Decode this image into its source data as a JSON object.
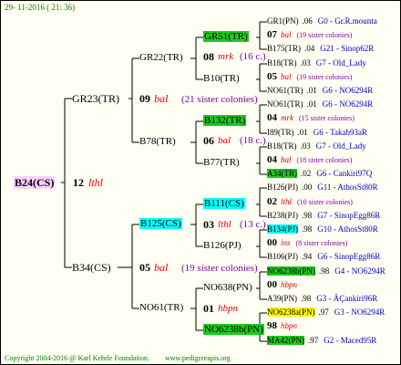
{
  "header": {
    "date": "29- 11-2016 ( 21: 36)"
  },
  "footer": {
    "copyright": "Copyright 2004-2016 @ Karl Kehrle Foundation.",
    "url": "www.pedigreeapis.org"
  },
  "colors": {
    "root_highlight": "#ffd0ff",
    "green_highlight": "#1ec81e",
    "cyan_highlight": "#00ffff",
    "yellow_highlight": "#ffff00",
    "lines": "#000000",
    "sister_colonies_text": "#8000a0",
    "ancestry_code_text": "#0000c0",
    "footer_text": "#008000"
  },
  "root": {
    "code": "B24(CS)",
    "num": "12",
    "tag": "lthl"
  },
  "gen1": [
    {
      "code": "GR23(TR)"
    },
    {
      "code": "B34(CS)"
    }
  ],
  "gen2_left": {
    "num": "09",
    "tag": "bal",
    "sister": "(21 sister colonies)"
  },
  "gen2_right": {
    "num": "05",
    "tag": "bal",
    "sister": "(19 sister colonies)"
  },
  "gen2": [
    {
      "code": "GR22(TR)"
    },
    {
      "code": "B78(TR)"
    },
    {
      "code": "B125(CS)"
    },
    {
      "code": "NO61(TR)"
    }
  ],
  "gen3_info": [
    {
      "num": "08",
      "tag": "mrk",
      "sister": "(16 c.)"
    },
    {
      "num": "06",
      "tag": "bal",
      "sister": "(18 c.)"
    },
    {
      "num": "03",
      "tag": "lthl",
      "sister": "(13 c.)"
    },
    {
      "num": "01",
      "tag": "hbpn",
      "sister": ""
    }
  ],
  "gen3": [
    {
      "code": "GR51(TR)"
    },
    {
      "code": "B10(TR)"
    },
    {
      "code": "B132(TR)"
    },
    {
      "code": "B77(TR)"
    },
    {
      "code": "B111(CS)"
    },
    {
      "code": "B126(PJ)"
    },
    {
      "code": "NO638(PN)"
    },
    {
      "code": "NO6238b(PN)"
    }
  ],
  "gen4_rows": [
    {
      "a": "GR1(PN)",
      "b": ".06",
      "c": "G0 - Gr.R.mounta"
    },
    {
      "a": "07",
      "b": "bal",
      "c": "(19 sister colonies)"
    },
    {
      "a": "B175(TR)",
      "b": ".04",
      "c": "G21 - Sinop62R"
    },
    {
      "a": "B18(TR)",
      "b": ".03",
      "c": "G7 - Old_Lady"
    },
    {
      "a": "05",
      "b": "bal",
      "c": "(19 sister colonies)"
    },
    {
      "a": "NO61(TR)",
      "b": ".01",
      "c": "G6 - NO6294R"
    },
    {
      "a": "NO61(TR)",
      "b": ".01",
      "c": "G6 - NO6294R"
    },
    {
      "a": "04",
      "b": "mrk",
      "c": "(15 sister colonies)"
    },
    {
      "a": "I89(TR)",
      "b": ".01",
      "c": "G6 - Takab93aR"
    },
    {
      "a": "B18(TR)",
      "b": ".03",
      "c": "G7 - Old_Lady"
    },
    {
      "a": "04",
      "b": "bal",
      "c": "(18 sister colonies)"
    },
    {
      "a": "A34(TR)",
      "b": ".02",
      "c": "G6 - Cankiri97Q"
    },
    {
      "a": "B126(PJ)",
      "b": ".00",
      "c": "G11 - AthosSt80R"
    },
    {
      "a": "02",
      "b": "lthl",
      "c": "(10 sister colonies)"
    },
    {
      "a": "B238(PJ)",
      "b": ".98",
      "c": "G7 - SinopEgg86R"
    },
    {
      "a": "B134(PJ)",
      "b": ".98",
      "c": "G10 - AthosSt80R"
    },
    {
      "a": "00",
      "b": "ins",
      "c": "(8 sister colonies)"
    },
    {
      "a": "B106(PJ)",
      "b": ".94",
      "c": "G6 - SinopEgg86R"
    },
    {
      "a": "NO6238b(PN)",
      "b": ".98",
      "c": "G4 - NO6294R"
    },
    {
      "a": "00",
      "b": "hbpn",
      "c": ""
    },
    {
      "a": "A39(PN)",
      "b": ".98",
      "c": "G3 - ÄÇankiri96R"
    },
    {
      "a": "NO6238a(PN)",
      "b": ".97",
      "c": "G3 - NO6294R"
    },
    {
      "a": "98",
      "b": "hbpn",
      "c": ""
    },
    {
      "a": "MA42(PN)",
      "b": ".97",
      "c": "G2 - Maced95R"
    }
  ]
}
